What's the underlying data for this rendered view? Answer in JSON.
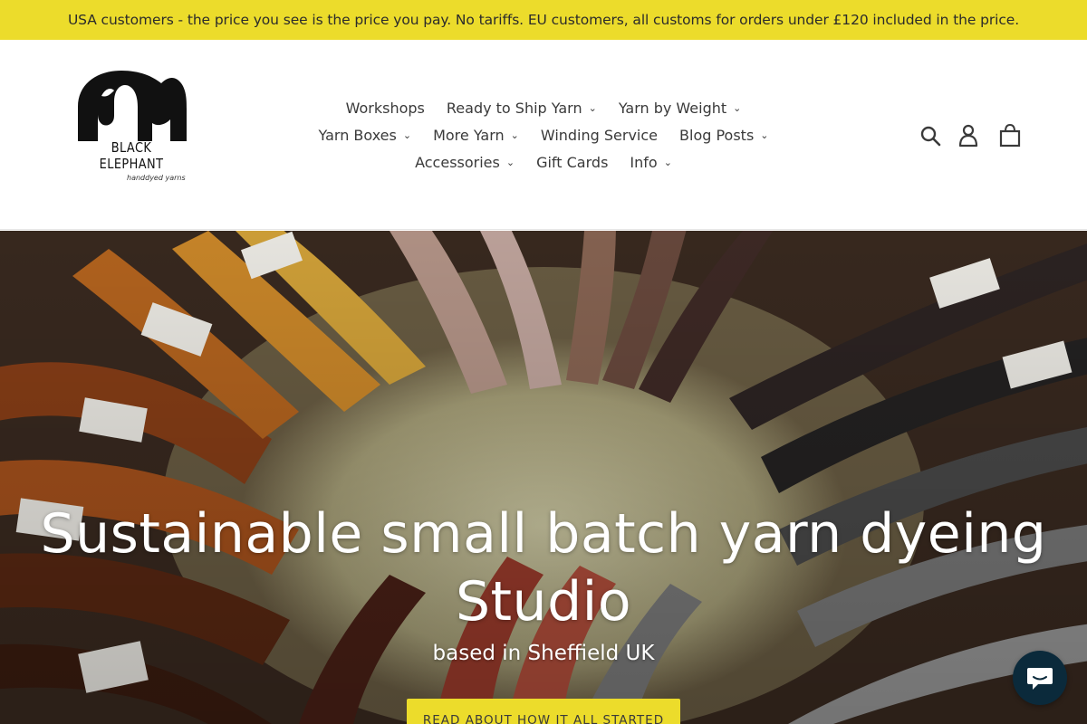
{
  "announcement": {
    "text": "USA customers - the price you see is the price you pay. No tariffs. EU customers, all customs for orders under £120 included in the price."
  },
  "logo": {
    "name": "BLACK ELEPHANT",
    "tagline": "handdyed yarns"
  },
  "nav": {
    "row1": [
      {
        "label": "Workshops",
        "dropdown": false
      },
      {
        "label": "Ready to Ship Yarn",
        "dropdown": true
      },
      {
        "label": "Yarn by Weight",
        "dropdown": true
      }
    ],
    "row2": [
      {
        "label": "Yarn Boxes",
        "dropdown": true
      },
      {
        "label": "More Yarn",
        "dropdown": true
      },
      {
        "label": "Winding Service",
        "dropdown": false
      },
      {
        "label": "Blog Posts",
        "dropdown": true
      }
    ],
    "row3": [
      {
        "label": "Accessories",
        "dropdown": true
      },
      {
        "label": "Gift Cards",
        "dropdown": false
      },
      {
        "label": "Info",
        "dropdown": true
      }
    ]
  },
  "header_icons": [
    "search-icon",
    "account-icon",
    "cart-icon"
  ],
  "hero": {
    "title_line1": "Sustainable small batch yarn dyeing",
    "title_line2": "Studio",
    "subtitle": "based in Sheffield UK",
    "button_label": "READ ABOUT HOW IT ALL STARTED"
  },
  "colors": {
    "accent": "#ecdc2b",
    "chat": "#0b2a3b"
  }
}
